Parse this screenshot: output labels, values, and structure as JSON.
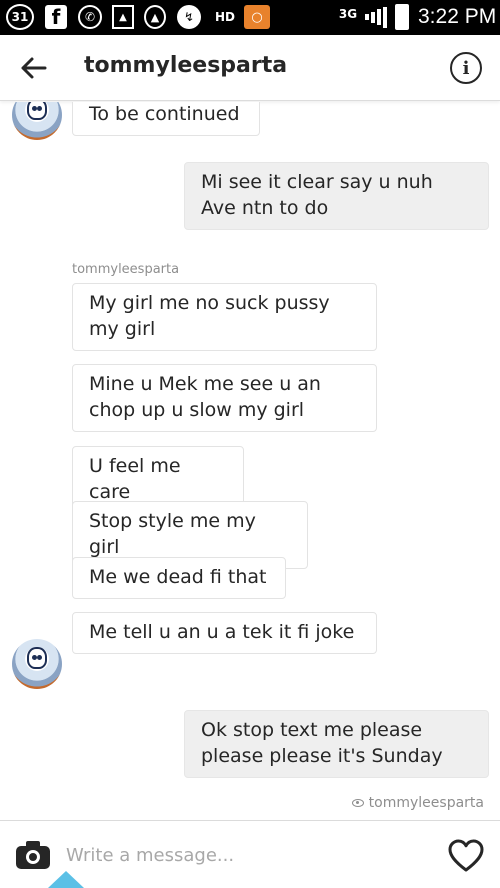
{
  "status_bar": {
    "calendar_day": "31",
    "facebook_glyph": "f",
    "hd_label": "HD",
    "network": "3G",
    "time": "3:22 PM",
    "icons": [
      "calendar-icon",
      "facebook-icon",
      "whatsapp-icon",
      "gallery-icon",
      "navigation-icon",
      "messenger-icon",
      "hd-icon",
      "warning-icon",
      "signal-icon",
      "battery-icon"
    ]
  },
  "header": {
    "title": "tommyleesparta",
    "back_icon": "arrow-left-icon",
    "info_icon": "info-icon",
    "info_glyph": "i"
  },
  "thread": {
    "sender_label": "tommyleesparta",
    "messages": [
      {
        "direction": "in",
        "text": "To be continued"
      },
      {
        "direction": "out",
        "text": "Mi see it clear say u nuh Ave ntn to do"
      },
      {
        "direction": "in",
        "text": "My girl me no suck pussy my girl"
      },
      {
        "direction": "in",
        "text": "Mine u Mek me see u an chop up u slow my girl"
      },
      {
        "direction": "in",
        "text": "U feel me care"
      },
      {
        "direction": "in",
        "text": "Stop style me my girl"
      },
      {
        "direction": "in",
        "text": "Me we dead fi that"
      },
      {
        "direction": "in",
        "text": "Me tell u an u a tek it fi joke"
      },
      {
        "direction": "out",
        "text": "Ok stop text me please please please it's Sunday"
      }
    ],
    "seen_by": "tommyleesparta"
  },
  "composer": {
    "placeholder": "Write a message...",
    "value": "",
    "camera_icon": "camera-icon",
    "like_icon": "heart-icon"
  },
  "colors": {
    "incoming_bubble": "#ffffff",
    "outgoing_bubble": "#efefef",
    "text": "#262626",
    "muted": "#8e8e8e",
    "warning": "#e8822c",
    "indicator": "#5bc0e6"
  }
}
